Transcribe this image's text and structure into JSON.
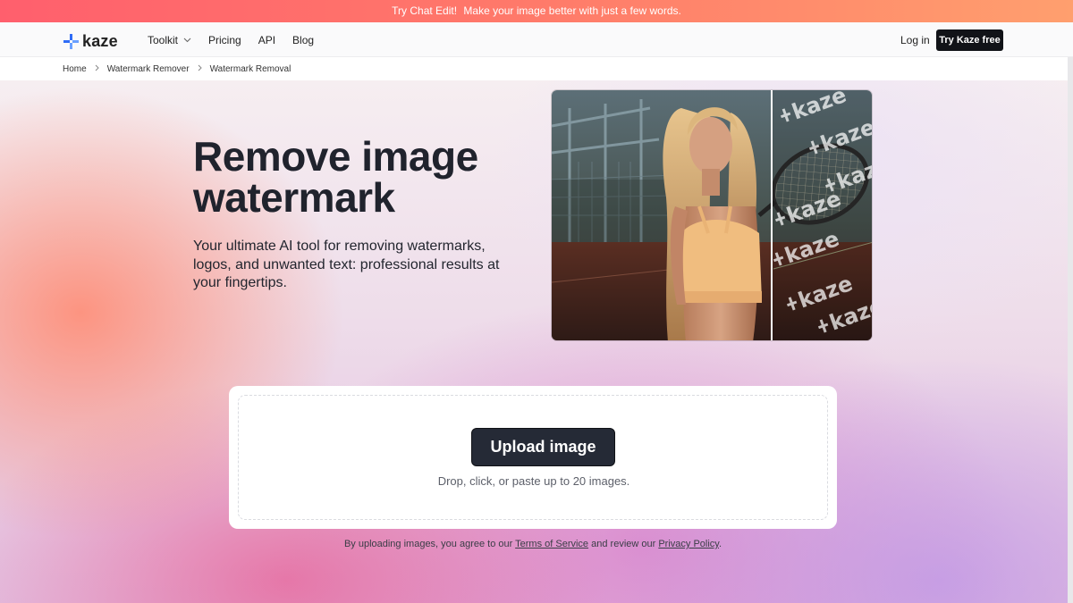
{
  "promo": {
    "link": "Try Chat Edit!",
    "text": "Make your image better with just a few words."
  },
  "header": {
    "logo_text": "kaze",
    "nav": [
      {
        "label": "Toolkit",
        "has_dropdown": true
      },
      {
        "label": "Pricing"
      },
      {
        "label": "API"
      },
      {
        "label": "Blog"
      }
    ],
    "login_label": "Log in",
    "try_label": "Try Kaze free"
  },
  "breadcrumb": [
    "Home",
    "Watermark Remover",
    "Watermark Removal"
  ],
  "hero": {
    "title": "Remove image watermark",
    "subtitle": "Your ultimate AI tool for removing watermarks, logos, and unwanted text: professional results at your fingertips.",
    "watermark_text": "kaze"
  },
  "upload": {
    "button_label": "Upload image",
    "hint": "Drop, click, or paste up to 20 images."
  },
  "terms": {
    "prefix": "By uploading images, you agree to our",
    "tos": "Terms of Service",
    "middle": "and review our",
    "privacy": "Privacy Policy",
    "suffix": "."
  },
  "colors": {
    "promo_start": "#ff5f6d",
    "promo_end": "#ff9f6e",
    "logo_blue": "#2f6cf6",
    "dark_button": "#111318"
  },
  "icons": {
    "logo": "kaze-plus-logo-icon",
    "dropdown": "chevron-down-icon",
    "breadcrumb_sep": "chevron-right-icon"
  }
}
